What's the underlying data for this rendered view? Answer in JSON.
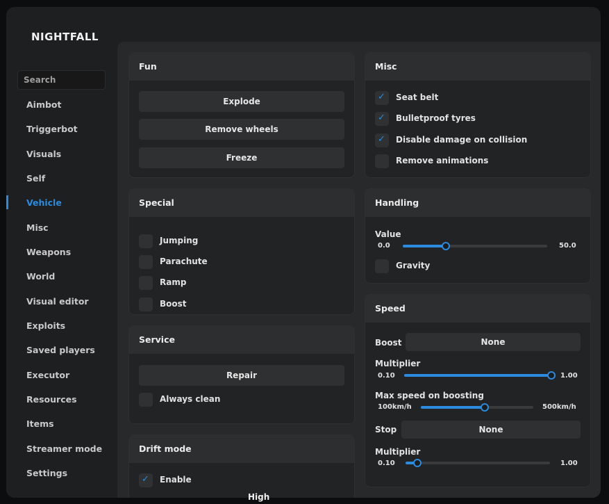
{
  "app": {
    "title": "NIGHTFALL"
  },
  "search": {
    "placeholder": "Search"
  },
  "sidebar": {
    "items": [
      {
        "label": "Aimbot"
      },
      {
        "label": "Triggerbot"
      },
      {
        "label": "Visuals"
      },
      {
        "label": "Self"
      },
      {
        "label": "Vehicle",
        "active": true
      },
      {
        "label": "Misc"
      },
      {
        "label": "Weapons"
      },
      {
        "label": "World"
      },
      {
        "label": "Visual editor"
      },
      {
        "label": "Exploits"
      },
      {
        "label": "Saved players"
      },
      {
        "label": "Executor"
      },
      {
        "label": "Resources"
      },
      {
        "label": "Items"
      },
      {
        "label": "Streamer mode"
      },
      {
        "label": "Settings"
      }
    ]
  },
  "fun": {
    "title": "Fun",
    "buttons": [
      "Explode",
      "Remove wheels",
      "Freeze"
    ]
  },
  "special": {
    "title": "Special",
    "options": [
      {
        "label": "Jumping",
        "checked": false
      },
      {
        "label": "Parachute",
        "checked": false
      },
      {
        "label": "Ramp",
        "checked": false
      },
      {
        "label": "Boost",
        "checked": false
      }
    ]
  },
  "service": {
    "title": "Service",
    "repair_label": "Repair",
    "always_clean": {
      "label": "Always clean",
      "checked": false
    }
  },
  "drift": {
    "title": "Drift mode",
    "enable": {
      "label": "Enable",
      "checked": true
    }
  },
  "misc": {
    "title": "Misc",
    "options": [
      {
        "label": "Seat belt",
        "checked": true
      },
      {
        "label": "Bulletproof tyres",
        "checked": true
      },
      {
        "label": "Disable damage on collision",
        "checked": true
      },
      {
        "label": "Remove animations",
        "checked": false
      }
    ]
  },
  "handling": {
    "title": "Handling",
    "value_label": "Value",
    "value_min": "0.0",
    "value_max": "50.0",
    "value_fraction": 0.3,
    "gravity": {
      "label": "Gravity",
      "checked": false
    }
  },
  "speed": {
    "title": "Speed",
    "boost_label": "Boost",
    "boost_value": "None",
    "multiplier_label": "Multiplier",
    "multiplier_min": "0.10",
    "multiplier_max": "1.00",
    "multiplier_fraction": 0.99,
    "maxspeed_label": "Max speed on boosting",
    "maxspeed_min": "100km/h",
    "maxspeed_max": "500km/h",
    "maxspeed_fraction": 0.57,
    "stop_label": "Stop",
    "stop_value": "None",
    "stop_multiplier_label": "Multiplier",
    "stop_multiplier_min": "0.10",
    "stop_multiplier_max": "1.00",
    "stop_multiplier_fraction": 0.08
  },
  "footer": {
    "text": "High"
  },
  "colors": {
    "accent": "#2a8bdf",
    "panel": "#222325",
    "header": "#2d2e30"
  }
}
